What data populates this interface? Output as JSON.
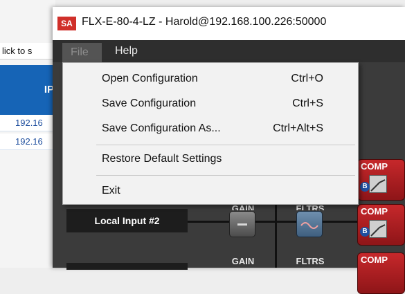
{
  "background_window": {
    "hint_text": "lick to s",
    "column_header": "IP",
    "rows": [
      "192.16",
      "192.16"
    ]
  },
  "app": {
    "logo_text": "SA",
    "title": "FLX-E-80-4-LZ - Harold@192.168.100.226:50000",
    "menu": {
      "file": "File",
      "help": "Help"
    }
  },
  "file_menu": {
    "items": [
      {
        "label": "Open Configuration",
        "shortcut": "Ctrl+O"
      },
      {
        "label": "Save Configuration",
        "shortcut": "Ctrl+S"
      },
      {
        "label": "Save Configuration As...",
        "shortcut": "Ctrl+Alt+S"
      },
      {
        "label": "Restore Default Settings",
        "shortcut": ""
      },
      {
        "label": "Exit",
        "shortcut": ""
      }
    ]
  },
  "workspace": {
    "input_labels": [
      "Local Input #2"
    ],
    "gain_label": "GAIN",
    "filters_label": "FLTRS",
    "comp_label": "COMP",
    "comp_badge": "B",
    "colors": {
      "comp": "#b51f22",
      "filters": "#4f6f8f",
      "gain": "#6a6a6a"
    }
  }
}
